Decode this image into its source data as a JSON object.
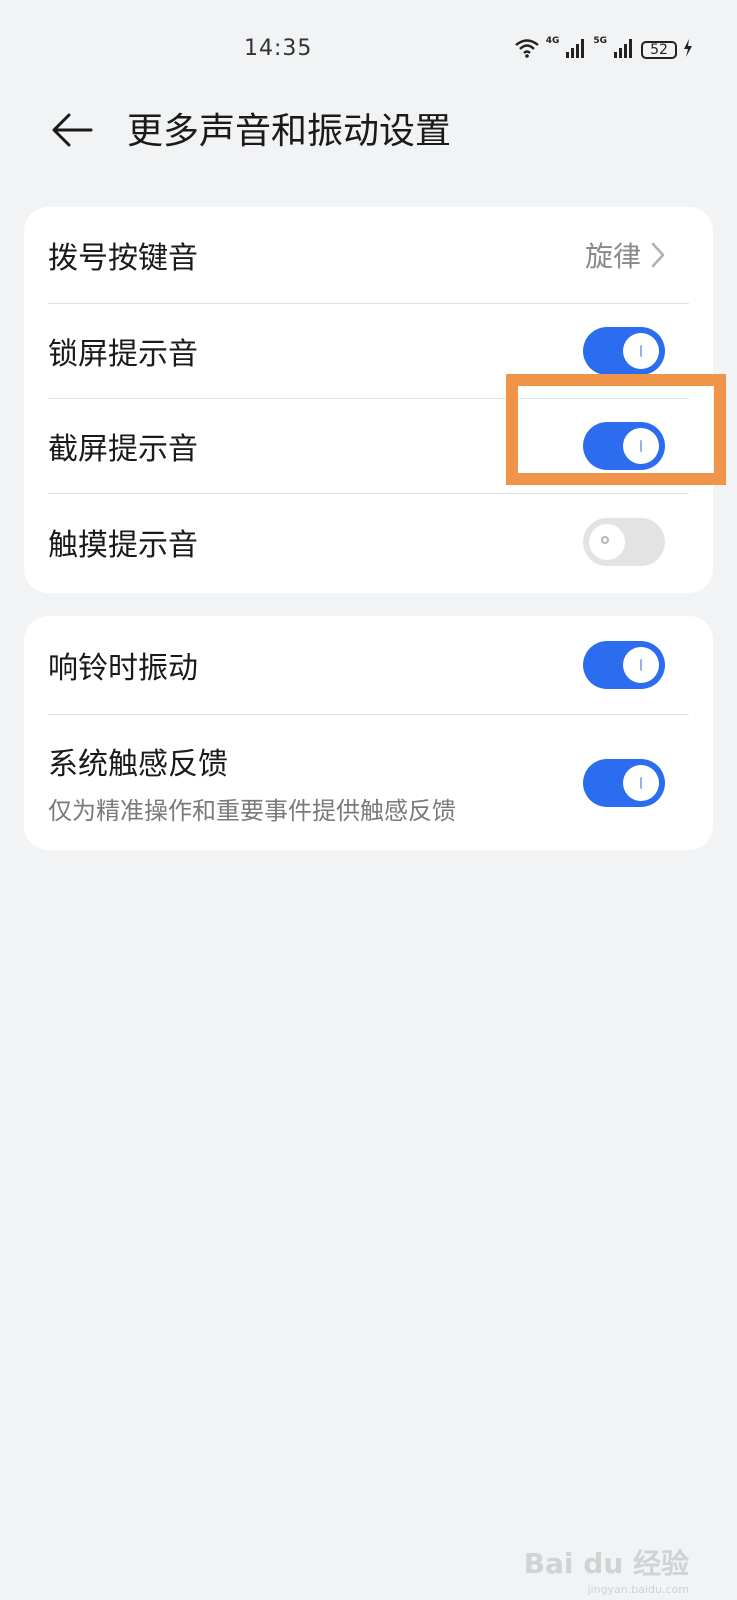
{
  "status_bar": {
    "time": "14:35",
    "network_a": "4G",
    "network_b": "5G",
    "battery": "52",
    "icons": [
      "wifi-icon",
      "signal-icon",
      "signal-icon",
      "battery-icon",
      "charging-icon"
    ]
  },
  "header": {
    "title": "更多声音和振动设置",
    "back_icon": "back-arrow-icon"
  },
  "group1": {
    "items": [
      {
        "label": "拨号按键音",
        "value": "旋律"
      },
      {
        "label": "锁屏提示音",
        "enabled": true
      },
      {
        "label": "截屏提示音",
        "enabled": true
      },
      {
        "label": "触摸提示音",
        "enabled": false
      }
    ]
  },
  "group2": {
    "items": [
      {
        "label": "响铃时振动",
        "enabled": true
      },
      {
        "label": "系统触感反馈",
        "sub": "仅为精准操作和重要事件提供触感反馈",
        "enabled": true
      }
    ]
  },
  "colors": {
    "toggle_on": "#2c6df0",
    "toggle_off": "#e3e3e3",
    "highlight": "#f0944a",
    "background": "#f1f3f5"
  },
  "watermark": {
    "brand": "Bai du 经验",
    "domain": "jingyan.baidu.com"
  }
}
